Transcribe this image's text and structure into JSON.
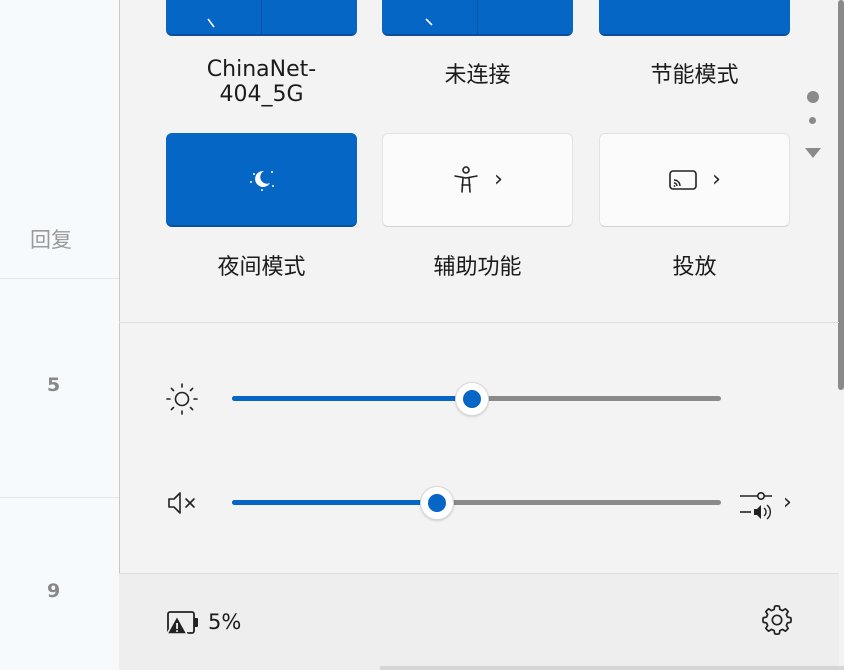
{
  "background": {
    "reply_label": "回复",
    "numbers": [
      "5",
      "9"
    ]
  },
  "tiles": [
    {
      "label": "ChinaNet-404_5G",
      "active": true,
      "icon": "wifi-icon"
    },
    {
      "label": "未连接",
      "active": true,
      "icon": "bluetooth-icon"
    },
    {
      "label": "节能模式",
      "active": true,
      "icon": "battery-saver-icon"
    },
    {
      "label": "夜间模式",
      "active": true,
      "icon": "night-light-icon"
    },
    {
      "label": "辅助功能",
      "active": false,
      "icon": "accessibility-icon"
    },
    {
      "label": "投放",
      "active": false,
      "icon": "cast-icon"
    }
  ],
  "sliders": {
    "brightness": {
      "icon": "brightness-icon",
      "value_percent": 49
    },
    "volume": {
      "icon": "volume-muted-icon",
      "value_percent": 42
    }
  },
  "footer": {
    "battery_text": "5%",
    "battery_icon": "battery-warning-icon",
    "settings_icon": "gear-icon"
  },
  "colors": {
    "accent": "#0566c5",
    "panel": "#f3f3f3"
  }
}
